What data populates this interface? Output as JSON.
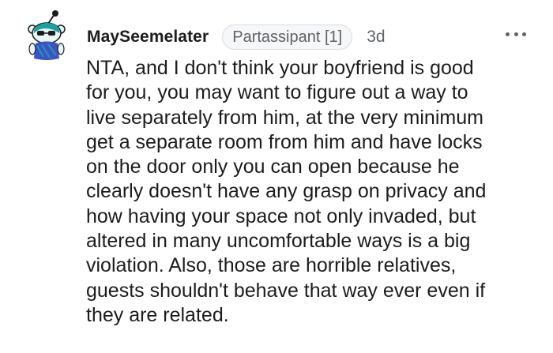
{
  "comment": {
    "username": "MaySeemelater",
    "flair": "Partassipant [1]",
    "timestamp": "3d",
    "more_options_icon": "ellipsis-icon",
    "avatar_icon": "snoo-avatar",
    "body_lines": [
      "NTA, and I don't think your boyfriend is good",
      "for you, you may want to figure out a way to",
      "live separately from him, at the very minimum",
      "get a separate room from him and have locks",
      "on the door only you can open because he",
      "clearly doesn't have any grasp on privacy and",
      "how having your space not only invaded, but",
      "altered in many uncomfortable ways is a big",
      "violation. Also, those are horrible relatives,",
      "guests shouldn't behave that way ever even if",
      "they are related."
    ]
  },
  "colors": {
    "text": "#1c1c1c",
    "meta": "#5f6368",
    "flair_bg": "#f6f7f8",
    "avatar_teal": "#17a2a3",
    "avatar_blue": "#3f51c8"
  }
}
